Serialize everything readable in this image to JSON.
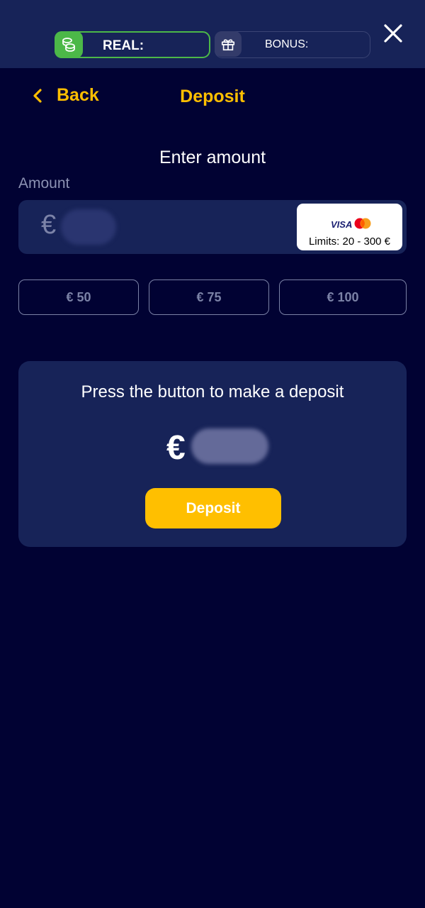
{
  "header": {
    "real_label": "REAL:",
    "bonus_label": "BONUS:",
    "icons": {
      "real": "coins-icon",
      "bonus": "gift-icon",
      "close": "close-icon"
    }
  },
  "nav": {
    "back_label": "Back",
    "title": "Deposit"
  },
  "form": {
    "heading": "Enter amount",
    "amount_label": "Amount",
    "currency_symbol": "€",
    "payment": {
      "visa_label": "VISA",
      "limits": "Limits: 20 - 300 €"
    },
    "quick_amounts": [
      "€ 50",
      "€ 75",
      "€ 100"
    ]
  },
  "panel": {
    "instruction": "Press the button to make a deposit",
    "currency_symbol": "€",
    "deposit_button_label": "Deposit"
  },
  "colors": {
    "background": "#010233",
    "surface": "#172358",
    "accent": "#ffbf00",
    "real_green": "#4cb848",
    "muted": "#7b82a6"
  }
}
